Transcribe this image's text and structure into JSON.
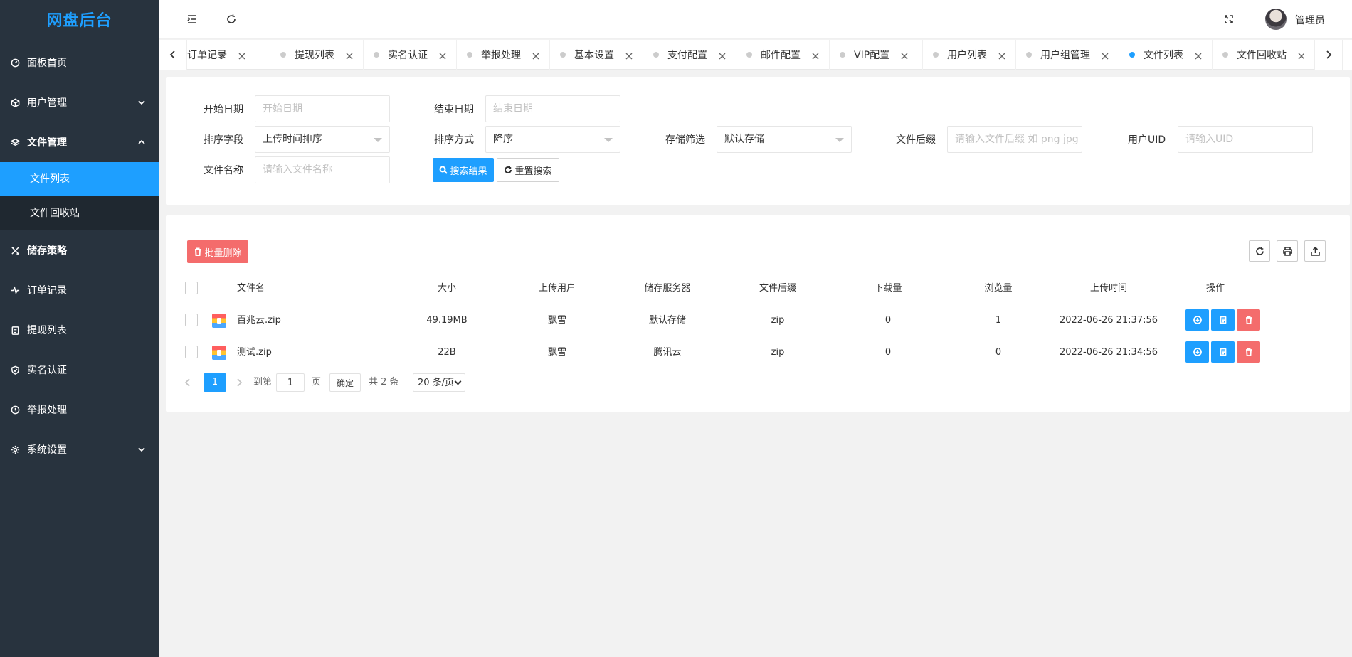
{
  "app": {
    "title": "网盘后台"
  },
  "sidebar": {
    "items": [
      {
        "label": "面板首页",
        "icon": "dashboard-icon"
      },
      {
        "label": "用户管理",
        "icon": "cube-icon"
      },
      {
        "label": "文件管理",
        "icon": "layers-icon"
      },
      {
        "label": "储存策略",
        "icon": "tools-icon"
      },
      {
        "label": "订单记录",
        "icon": "pulse-icon"
      },
      {
        "label": "提现列表",
        "icon": "clipboard-icon"
      },
      {
        "label": "实名认证",
        "icon": "shield-icon"
      },
      {
        "label": "举报处理",
        "icon": "info-icon"
      },
      {
        "label": "系统设置",
        "icon": "gear-icon"
      }
    ],
    "file_sub": [
      {
        "label": "文件列表"
      },
      {
        "label": "文件回收站"
      }
    ]
  },
  "header": {
    "user_name": "管理员"
  },
  "tabs": [
    {
      "label": "订单记录"
    },
    {
      "label": "提现列表"
    },
    {
      "label": "实名认证"
    },
    {
      "label": "举报处理"
    },
    {
      "label": "基本设置"
    },
    {
      "label": "支付配置"
    },
    {
      "label": "邮件配置"
    },
    {
      "label": "VIP配置"
    },
    {
      "label": "用户列表"
    },
    {
      "label": "用户组管理"
    },
    {
      "label": "文件列表"
    },
    {
      "label": "文件回收站"
    }
  ],
  "search": {
    "start_date": {
      "label": "开始日期",
      "placeholder": "开始日期"
    },
    "end_date": {
      "label": "结束日期",
      "placeholder": "结束日期"
    },
    "sort_field": {
      "label": "排序字段",
      "value": "上传时间排序"
    },
    "sort_order": {
      "label": "排序方式",
      "value": "降序"
    },
    "storage": {
      "label": "存储筛选",
      "value": "默认存储"
    },
    "suffix": {
      "label": "文件后缀",
      "placeholder": "请输入文件后缀 如 png jpg 等"
    },
    "uid": {
      "label": "用户UID",
      "placeholder": "请输入UID"
    },
    "file_name": {
      "label": "文件名称",
      "placeholder": "请输入文件名称"
    },
    "search_btn": "搜索结果",
    "reset_btn": "重置搜索"
  },
  "table": {
    "batch_delete": "批量删除",
    "columns": [
      "文件名",
      "大小",
      "上传用户",
      "储存服务器",
      "文件后缀",
      "下载量",
      "浏览量",
      "上传时间",
      "操作"
    ],
    "rows": [
      {
        "name": "百兆云.zip",
        "size": "49.19MB",
        "user": "飘雪",
        "server": "默认存储",
        "suffix": "zip",
        "downloads": "0",
        "views": "1",
        "time": "2022-06-26 21:37:56"
      },
      {
        "name": "测试.zip",
        "size": "22B",
        "user": "飘雪",
        "server": "腾讯云",
        "suffix": "zip",
        "downloads": "0",
        "views": "0",
        "time": "2022-06-26 21:34:56"
      }
    ]
  },
  "pager": {
    "current": "1",
    "goto_label": "到第",
    "goto_value": "1",
    "page_label": "页",
    "confirm": "确定",
    "total": "共 2 条",
    "per_page": "20 条/页"
  }
}
